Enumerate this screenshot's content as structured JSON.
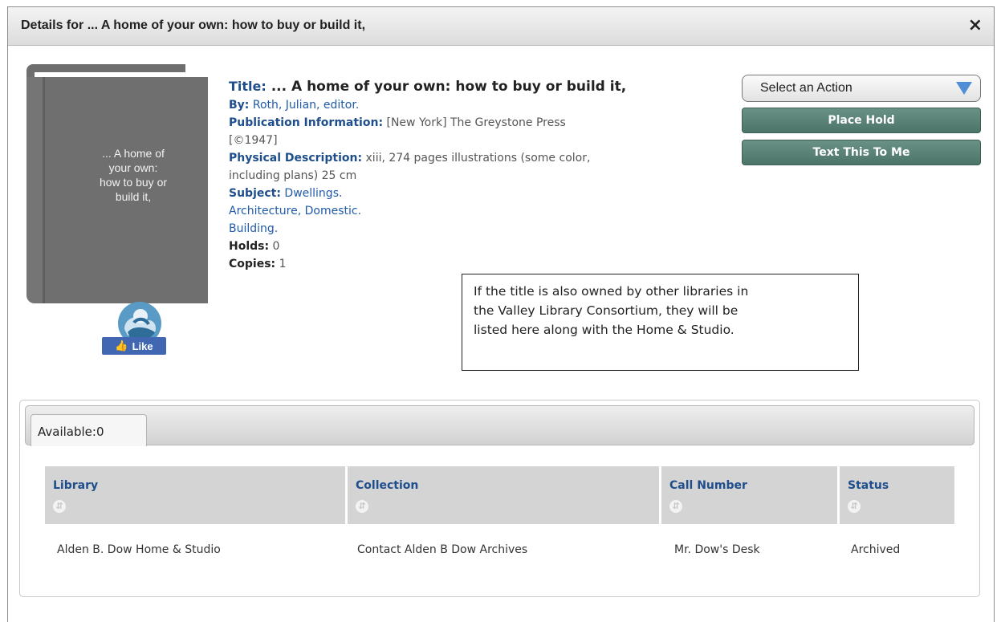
{
  "dialog": {
    "title": "Details for ... A home of your own: how to buy or build it,",
    "close_icon": "×"
  },
  "cover": {
    "lines": [
      "... A home of",
      "your own:",
      "how to buy or",
      "build it,"
    ],
    "logo_icon": "cloud-logo-icon"
  },
  "like": {
    "label": "Like",
    "icon": "thumbs-up-icon"
  },
  "details": {
    "title_label": "Title:",
    "title_value": "... A home of your own: how to buy or build it,",
    "by_label": "By:",
    "by_value": "Roth, Julian, editor.",
    "pub_label": "Publication Information:",
    "pub_value_1": "[New York] The Greystone Press",
    "pub_value_2": "[©1947]",
    "phys_label": "Physical Description:",
    "phys_value_1": "xiii, 274 pages illustrations (some color,",
    "phys_value_2": "including plans) 25 cm",
    "subject_label": "Subject:",
    "subjects": [
      "Dwellings.",
      "Architecture, Domestic.",
      "Building."
    ],
    "holds_label": "Holds:",
    "holds_value": "0",
    "copies_label": "Copies:",
    "copies_value": "1"
  },
  "actions": {
    "select_label": "Select an Action",
    "place_hold": "Place Hold",
    "text_to_me": "Text This To Me"
  },
  "note": {
    "line1": "If the title is also owned by other libraries in",
    "line2": "the Valley Library Consortium, they will be",
    "line3": "listed here along with the Home & Studio."
  },
  "availability": {
    "tab_label": "Available:0",
    "columns": [
      "Library",
      "Collection",
      "Call Number",
      "Status"
    ],
    "rows": [
      [
        "Alden B. Dow Home & Studio",
        "Contact Alden B Dow Archives",
        "Mr. Dow's Desk",
        "Archived"
      ]
    ]
  },
  "colors": {
    "label_blue": "#1f4e8c",
    "link_blue": "#1f5ba8",
    "button_green": "#5a8176",
    "like_blue": "#4267b2"
  }
}
